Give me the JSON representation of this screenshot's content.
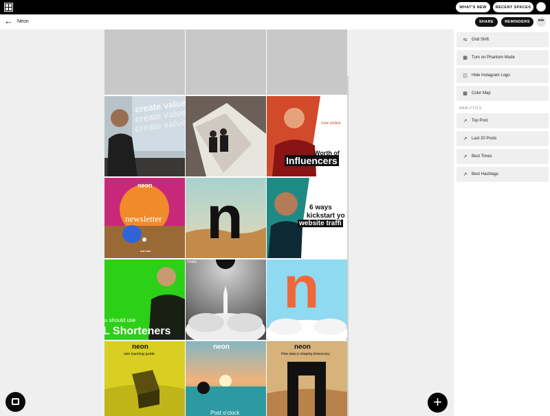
{
  "topbar": {
    "whats_new": "WHAT'S NEW",
    "recent_spaces": "RECENT SPACES"
  },
  "subbar": {
    "title": "Neon",
    "share": "SHARE",
    "reminders": "REMINDERS",
    "more": "•••"
  },
  "tiles": [
    {
      "bg": "#c8c8c8"
    },
    {
      "bg": "#c8c8c8"
    },
    {
      "bg": "#c8c8c8"
    },
    {
      "bg": "#b6c2c7",
      "text": "create value"
    },
    {
      "bg": "#5f5650"
    },
    {
      "bg": "#d14a2a",
      "text": "now online",
      "text2": "Worth of",
      "text3": "Influencers"
    },
    {
      "bg": "#c8287a",
      "text": "neon",
      "text2": "newsletter",
      "text3": "out now"
    },
    {
      "bg": "#cfa66a",
      "text": "n"
    },
    {
      "bg": "#2a8f8a",
      "text": "6 ways",
      "text2": "kickstart yo",
      "text3": "website traffi"
    },
    {
      "bg": "#2cd016",
      "text": "u should use",
      "text2": "L Shorteners"
    },
    {
      "bg": "#9a9a9a",
      "text": "nnels"
    },
    {
      "bg": "#8ed8ef",
      "text": "n"
    },
    {
      "bg": "#d6cf21",
      "text": "neon",
      "text2": "utm tracking guide"
    },
    {
      "bg": "#e0a06a",
      "text": "neon",
      "text2": "Post o'clock"
    },
    {
      "bg": "#c7a36e",
      "text": "neon",
      "text2": "How data is shaping democracy"
    }
  ],
  "panel": {
    "items": [
      {
        "label": "Grid Shift",
        "icon": "⇆"
      },
      {
        "label": "Turn on Phantom Mode",
        "icon": "▦"
      },
      {
        "label": "Hide Instagram Logo",
        "icon": "◫"
      },
      {
        "label": "Color Map",
        "icon": "▩"
      }
    ],
    "analytics_label": "ANALYTICS",
    "analytics": [
      {
        "label": "Top Post",
        "icon": "↗"
      },
      {
        "label": "Last 20 Posts",
        "icon": "↗"
      },
      {
        "label": "Best Times",
        "icon": "↗"
      },
      {
        "label": "Best Hashtags",
        "icon": "↗"
      }
    ]
  },
  "fab": "+"
}
